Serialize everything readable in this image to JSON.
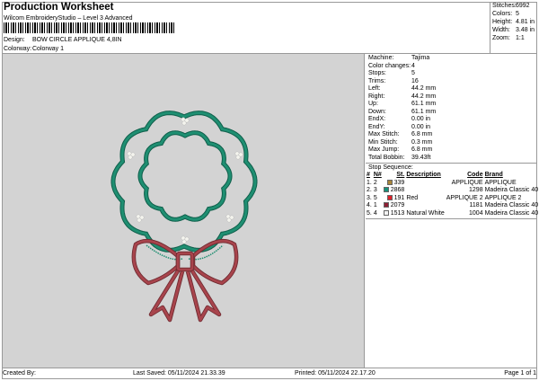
{
  "header": {
    "title": "Production Worksheet",
    "subtitle": "Wilcom EmbroideryStudio – Level 3 Advanced",
    "design_label": "Design:",
    "design": "BOW CIRCLE APPLIQUE 4,8IN",
    "colorway_label": "Colorway:",
    "colorway": "Colorway 1"
  },
  "summary": [
    {
      "k": "Stitches:",
      "v": "6992"
    },
    {
      "k": "Colors:",
      "v": "5"
    },
    {
      "k": "Height:",
      "v": "4.81 in"
    },
    {
      "k": "Width:",
      "v": "3.48 in"
    },
    {
      "k": "Zoom:",
      "v": "1:1"
    }
  ],
  "stats": [
    {
      "k": "Machine:",
      "v": "Tajima"
    },
    {
      "k": "Color changes:",
      "v": "4"
    },
    {
      "k": "Stops:",
      "v": "5"
    },
    {
      "k": "Trims:",
      "v": "16"
    },
    {
      "k": "Left:",
      "v": "44.2 mm"
    },
    {
      "k": "Right:",
      "v": "44.2 mm"
    },
    {
      "k": "Up:",
      "v": "61.1 mm"
    },
    {
      "k": "Down:",
      "v": "61.1 mm"
    },
    {
      "k": "EndX:",
      "v": "0.00 in"
    },
    {
      "k": "EndY:",
      "v": "0.00 in"
    },
    {
      "k": "Max Stitch:",
      "v": "6.8 mm"
    },
    {
      "k": "Min Stitch:",
      "v": "0.3 mm"
    },
    {
      "k": "Max Jump:",
      "v": "6.8 mm"
    },
    {
      "k": "Total Bobbin:",
      "v": "39.43ft"
    }
  ],
  "stop_sequence": {
    "title": "Stop Sequence:",
    "headers": [
      "#",
      "N#",
      "St.",
      "Description",
      "Code",
      "Brand"
    ],
    "rows": [
      {
        "n": "1.",
        "num": "2",
        "color": "#a8853a",
        "st": "339",
        "desc": "",
        "code": "APPLIQUE",
        "brand": "APPLIQUE"
      },
      {
        "n": "2.",
        "num": "3",
        "color": "#17927a",
        "st": "2868",
        "desc": "",
        "code": "1298",
        "brand": "Madeira Classic 40"
      },
      {
        "n": "3.",
        "num": "5",
        "color": "#e0202a",
        "st": "191",
        "desc": "Red",
        "code": "APPLIQUE 2",
        "brand": "APPLIQUE 2"
      },
      {
        "n": "4.",
        "num": "1",
        "color": "#8e1f35",
        "st": "2079",
        "desc": "",
        "code": "1181",
        "brand": "Madeira Classic 40"
      },
      {
        "n": "5.",
        "num": "4",
        "color": "#f2f2f2",
        "st": "1513",
        "desc": "Natural White",
        "code": "1004",
        "brand": "Madeira Classic 40"
      }
    ]
  },
  "footer": {
    "created": "Created By:",
    "saved": "Last Saved: 05/11/2024 21.33.39",
    "printed": "Printed: 05/11/2024 22.17.20",
    "page": "Page 1 of 1"
  },
  "colors": {
    "green": "#1f8f72",
    "red": "#a8444c",
    "canvas": "#d3d3d3"
  }
}
